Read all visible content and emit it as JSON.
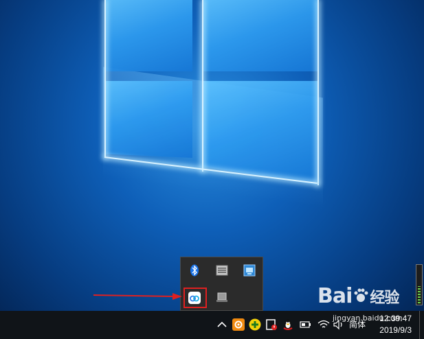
{
  "taskbar": {
    "time": "12:39:47",
    "date": "2019/9/3",
    "language": "简体"
  },
  "tray_flyout": {
    "icons": [
      "bluetooth-icon",
      "keyboard-icon",
      "network-adapter-icon",
      "baidu-netdisk-icon",
      "usb-device-icon"
    ]
  },
  "watermark": {
    "brand": "Bai",
    "brand_cn": "经验",
    "url": "jingyan.baidu.com"
  },
  "colors": {
    "highlight": "#e02020",
    "taskbar": "#101418",
    "flyout": "#2b2b2b"
  },
  "volume_level": 0.45
}
